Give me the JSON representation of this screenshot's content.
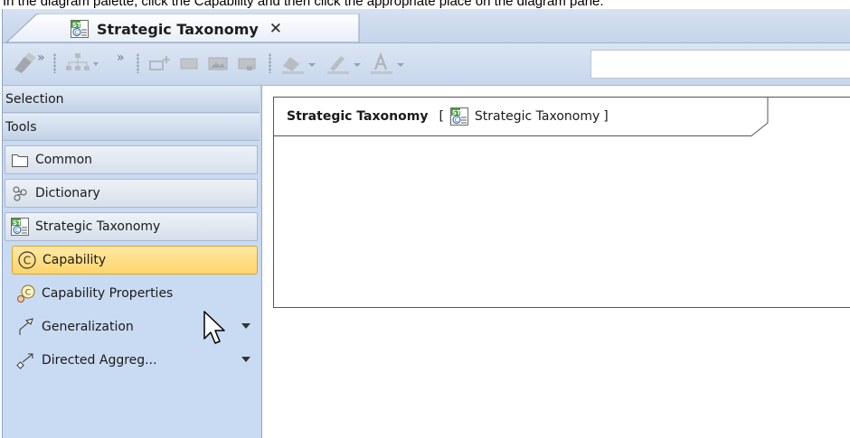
{
  "instruction": "In the diagram palette, click the Capability and then click the appropriate place on the diagram pane.",
  "tab": {
    "title": "Strategic Taxonomy",
    "close_glyph": "✕",
    "icon": "strategic-taxonomy-diagram-icon"
  },
  "toolbar": {
    "overflow_glyph": "»",
    "combo_value": ""
  },
  "palette": {
    "headers": [
      "Selection",
      "Tools"
    ],
    "groups": [
      {
        "label": "Common",
        "icon": "folder-icon"
      },
      {
        "label": "Dictionary",
        "icon": "dictionary-icon"
      },
      {
        "label": "Strategic Taxonomy",
        "icon": "strategic-taxonomy-diagram-icon"
      }
    ],
    "items": [
      {
        "label": "Capability",
        "icon": "capability-icon",
        "selected": true
      },
      {
        "label": "Capability Properties",
        "icon": "capability-property-icon",
        "selected": false
      },
      {
        "label": "Generalization",
        "icon": "generalization-icon",
        "selected": false
      },
      {
        "label": "Directed Aggreg...",
        "icon": "directed-aggregation-icon",
        "selected": false
      }
    ]
  },
  "diagram": {
    "name": "Strategic Taxonomy",
    "bracket_open": "[",
    "bracket_close": "]",
    "type_label": "Strategic Taxonomy"
  },
  "colors": {
    "window_bg": "#c6d6ec",
    "selected_item_bg": "#fdd56a",
    "selected_item_border": "#d8a531",
    "icon_green": "#4aa53a"
  }
}
